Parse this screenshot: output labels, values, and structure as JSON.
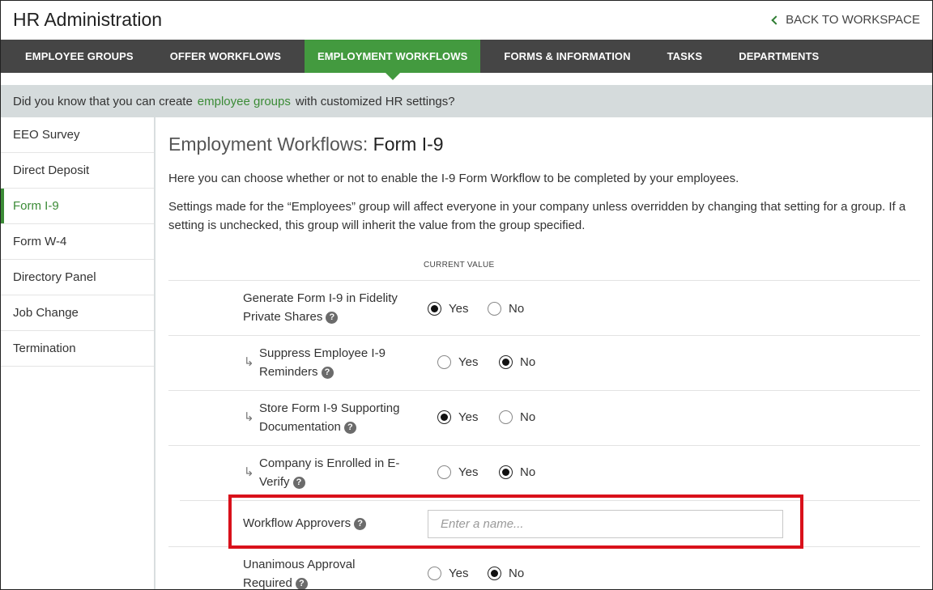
{
  "header": {
    "title": "HR Administration",
    "back_label": "BACK TO WORKSPACE"
  },
  "nav": {
    "items": [
      {
        "label": "EMPLOYEE GROUPS"
      },
      {
        "label": "OFFER WORKFLOWS"
      },
      {
        "label": "EMPLOYMENT WORKFLOWS",
        "active": true
      },
      {
        "label": "FORMS & INFORMATION"
      },
      {
        "label": "TASKS"
      },
      {
        "label": "DEPARTMENTS"
      }
    ]
  },
  "banner": {
    "prefix": "Did you know that you can create",
    "link": "employee groups",
    "suffix": "with customized HR settings?"
  },
  "sidebar": {
    "items": [
      {
        "label": "EEO Survey"
      },
      {
        "label": "Direct Deposit"
      },
      {
        "label": "Form I-9",
        "active": true
      },
      {
        "label": "Form W-4"
      },
      {
        "label": "Directory Panel"
      },
      {
        "label": "Job Change"
      },
      {
        "label": "Termination"
      }
    ]
  },
  "main": {
    "title_prefix": "Employment Workflows:",
    "title_bold": "Form I-9",
    "desc1": "Here you can choose whether or not to enable the I-9 Form Workflow to be completed by your employees.",
    "desc2": "Settings made for the “Employees” group will affect everyone in your company unless overridden by changing that setting for a group. If a setting is unchecked, this group will inherit the value from the group specified.",
    "col_header": "CURRENT VALUE",
    "help_glyph": "?",
    "sub_arrow": "↳",
    "yes_label": "Yes",
    "no_label": "No",
    "settings": [
      {
        "line1": "Generate Form I-9 in Fidelity",
        "line2": "Private Shares",
        "value": "Yes"
      },
      {
        "line1": "Suppress Employee I-9",
        "line2": "Reminders",
        "value": "No"
      },
      {
        "line1": "Store Form I-9 Supporting",
        "line2": "Documentation",
        "value": "Yes"
      },
      {
        "line1": "Company is Enrolled in E-",
        "line2": "Verify",
        "value": "No"
      },
      {
        "label": "Workflow Approvers",
        "placeholder": "Enter a name...",
        "input_value": ""
      },
      {
        "line1": "Unanimous Approval",
        "line2": "Required",
        "value": "No"
      }
    ]
  },
  "colors": {
    "nav_bg": "#454545",
    "accent_green": "#439a3f",
    "link_green": "#3b8b36",
    "banner_bg": "#d5dbdc",
    "highlight_red": "#d9111b"
  }
}
